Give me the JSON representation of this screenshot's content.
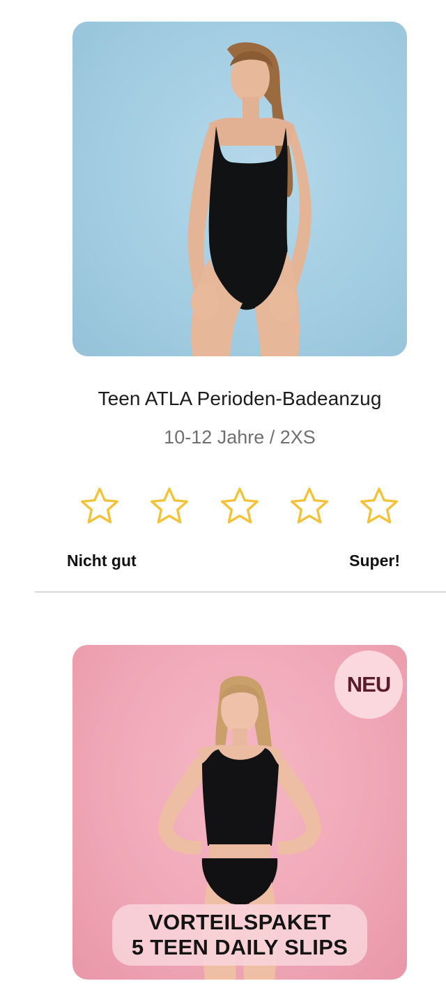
{
  "product_one": {
    "title": "Teen ATLA Perioden-Badeanzug",
    "variant": "10-12 Jahre / 2XS",
    "image_description_icon": "model-photo-swimsuit"
  },
  "rating": {
    "stars": 5,
    "selected": 0,
    "low_label": "Nicht gut",
    "high_label": "Super!",
    "star_color": "#f2c33a"
  },
  "product_two": {
    "badge": "NEU",
    "promo_line_1": "VORTEILSPAKET",
    "promo_line_2": "5 TEEN DAILY SLIPS",
    "image_description_icon": "model-photo-slips"
  },
  "colors": {
    "card_one_bg": "#a3cde2",
    "card_two_bg": "#f0a8b7",
    "badge_text": "#5a1c2c"
  }
}
